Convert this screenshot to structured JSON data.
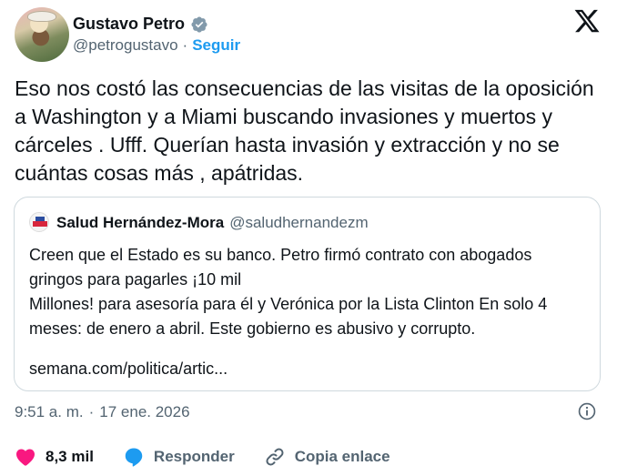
{
  "author": {
    "name": "Gustavo Petro",
    "handle": "@petrogustavo",
    "separator": "·",
    "follow_label": "Seguir"
  },
  "tweet": {
    "text": "Eso nos costó las consecuencias de las visitas de la oposición a Washington y a Miami buscando invasiones y muertos y cárceles . Ufff. Querían hasta invasión y extracción y no se cuántas cosas más , apátridas."
  },
  "quote": {
    "name": "Salud Hernández-Mora",
    "handle": "@saludhernandezm",
    "paragraph_1": "Creen que el Estado es su banco. Petro firmó contrato con abogados gringos para pagarles ¡10 mil",
    "paragraph_2": "Millones! para asesoría para él y Verónica por la Lista Clinton En solo 4 meses: de enero a abril. Este gobierno es abusivo y corrupto.",
    "link": "semana.com/politica/artic..."
  },
  "meta": {
    "time": "9:51 a. m.",
    "separator": "·",
    "date": "17 ene. 2026"
  },
  "actions": {
    "likes": "8,3 mil",
    "reply_label": "Responder",
    "copy_link_label": "Copia enlace"
  },
  "colors": {
    "accent": "#1d9bf0",
    "like": "#f91880",
    "secondary_text": "#536471",
    "border": "#cfd9de"
  },
  "icons": [
    "verified-badge-icon",
    "x-logo-icon",
    "info-icon",
    "heart-icon",
    "reply-icon",
    "link-icon"
  ]
}
